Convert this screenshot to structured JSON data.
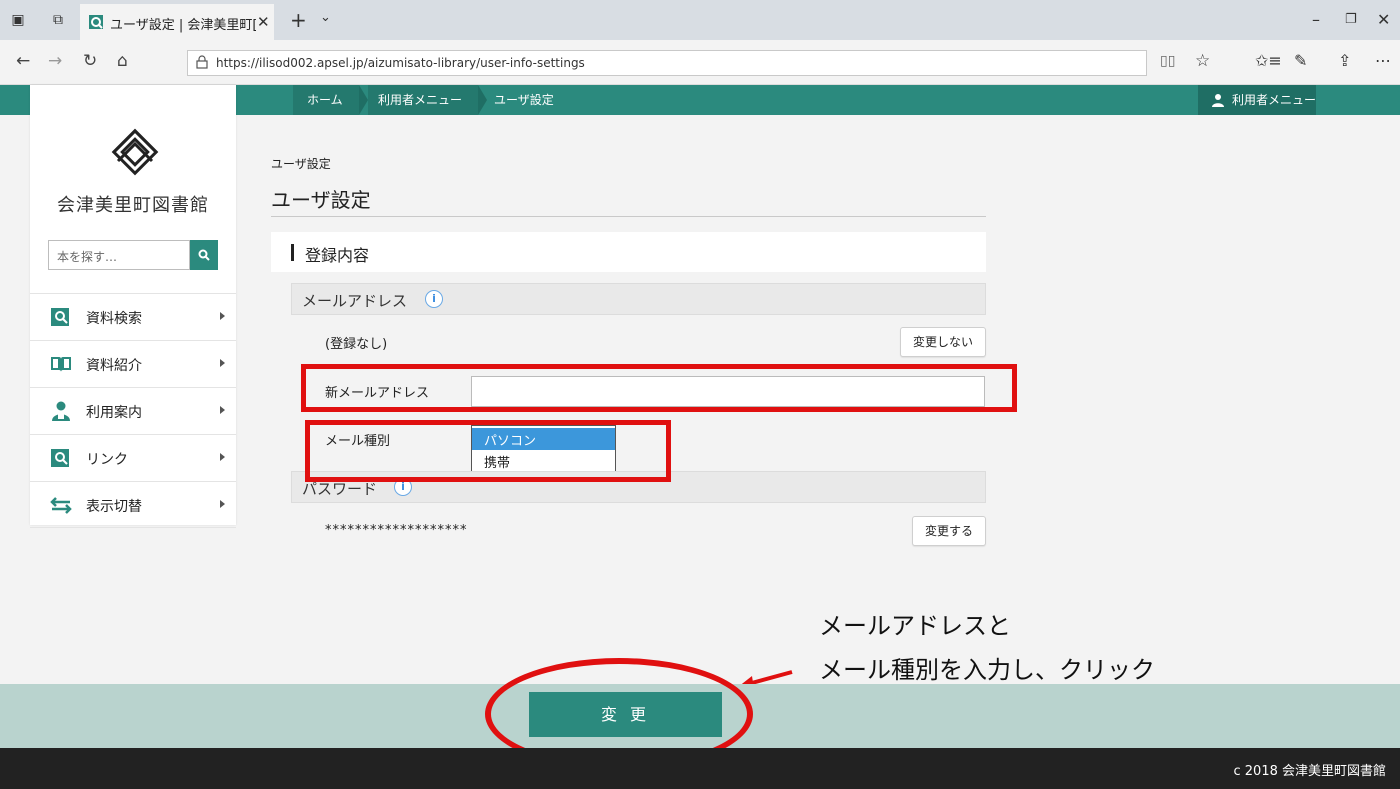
{
  "browser": {
    "tab_title": "ユーザ設定 | 会津美里町[",
    "url": "https://ilisod002.apsel.jp/aizumisato-library/user-info-settings"
  },
  "breadcrumb": {
    "home": "ホーム",
    "user_menu": "利用者メニュー",
    "current": "ユーザ設定"
  },
  "header": {
    "user_menu_button": "利用者メニュー"
  },
  "sidebar": {
    "library_name": "会津美里町図書館",
    "search_placeholder": "本を探す…",
    "items": [
      {
        "label": "資料検索",
        "icon": "search-book-icon"
      },
      {
        "label": "資料紹介",
        "icon": "open-book-icon"
      },
      {
        "label": "利用案内",
        "icon": "person-icon"
      },
      {
        "label": "リンク",
        "icon": "link-search-icon"
      },
      {
        "label": "表示切替",
        "icon": "switch-arrows-icon"
      }
    ]
  },
  "main": {
    "crumb_small": "ユーザ設定",
    "page_title": "ユーザ設定",
    "section_title": "登録内容",
    "email": {
      "heading": "メールアドレス",
      "current_value": "(登録なし)",
      "no_change_button": "変更しない",
      "new_label": "新メールアドレス",
      "new_value": "",
      "type_label": "メール種別",
      "type_options": [
        "パソコン",
        "携帯"
      ],
      "type_selected": "パソコン"
    },
    "password": {
      "heading": "パスワード",
      "masked_value": "*******************",
      "change_button": "変更する"
    },
    "submit_button": "変 更"
  },
  "annotation": {
    "line1": "メールアドレスと",
    "line2": "メール種別を入力し、クリック",
    "color": "#e01010"
  },
  "footer": {
    "copyright": "c 2018 会津美里町図書館"
  },
  "colors": {
    "brand_teal": "#2b8a7e",
    "footer_band": "#b9d3ce",
    "footer_dark": "#222222",
    "select_highlight": "#3c97db"
  }
}
